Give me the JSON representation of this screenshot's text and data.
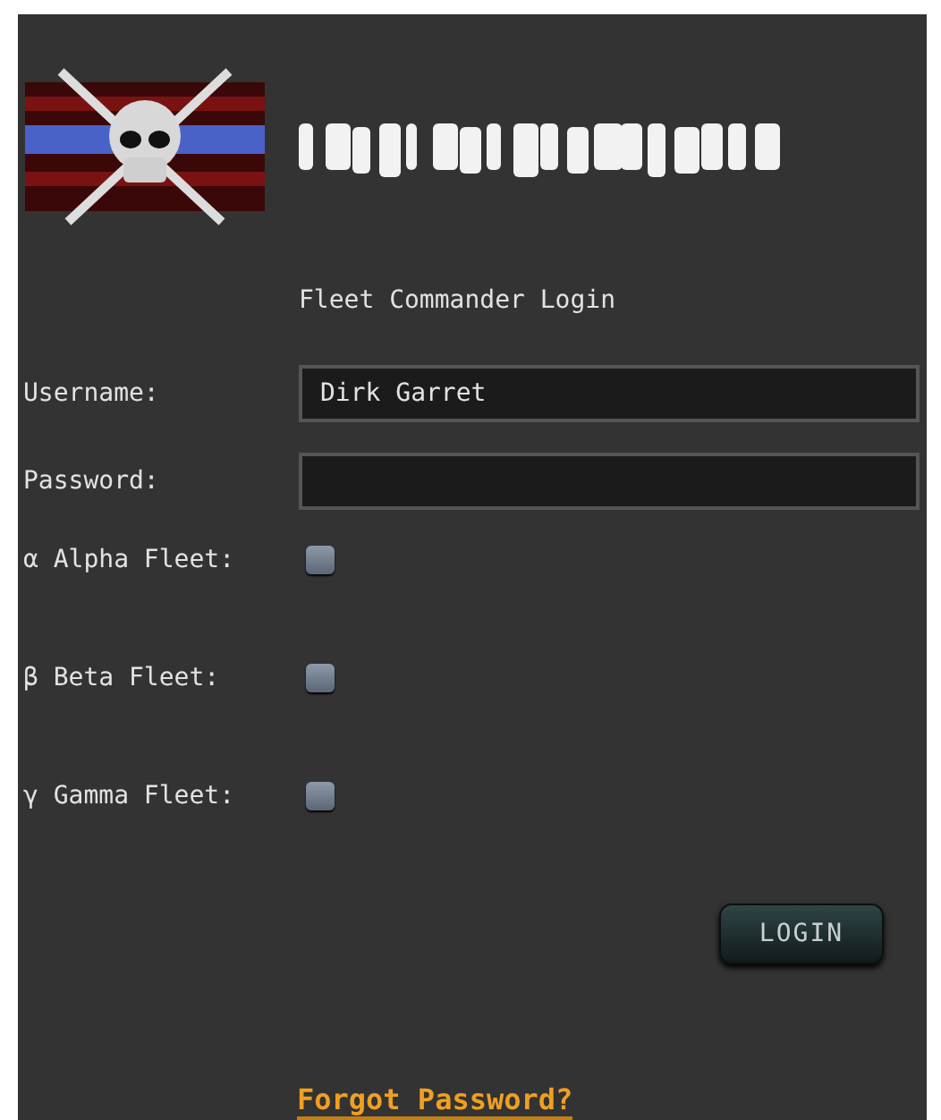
{
  "heading": "Fleet Commander Login",
  "fields": [
    {
      "label": "Username:",
      "value": "Dirk Garret"
    },
    {
      "label": "Password:"
    }
  ],
  "fleets": [
    {
      "symbol": "α",
      "label": "Alpha Fleet:",
      "checked": false
    },
    {
      "symbol": "β",
      "label": "Beta Fleet:",
      "checked": false
    },
    {
      "symbol": "γ",
      "label": "Gamma Fleet:",
      "checked": false
    }
  ],
  "login_button": "LOGIN",
  "forgot_link": "Forgot Password?"
}
